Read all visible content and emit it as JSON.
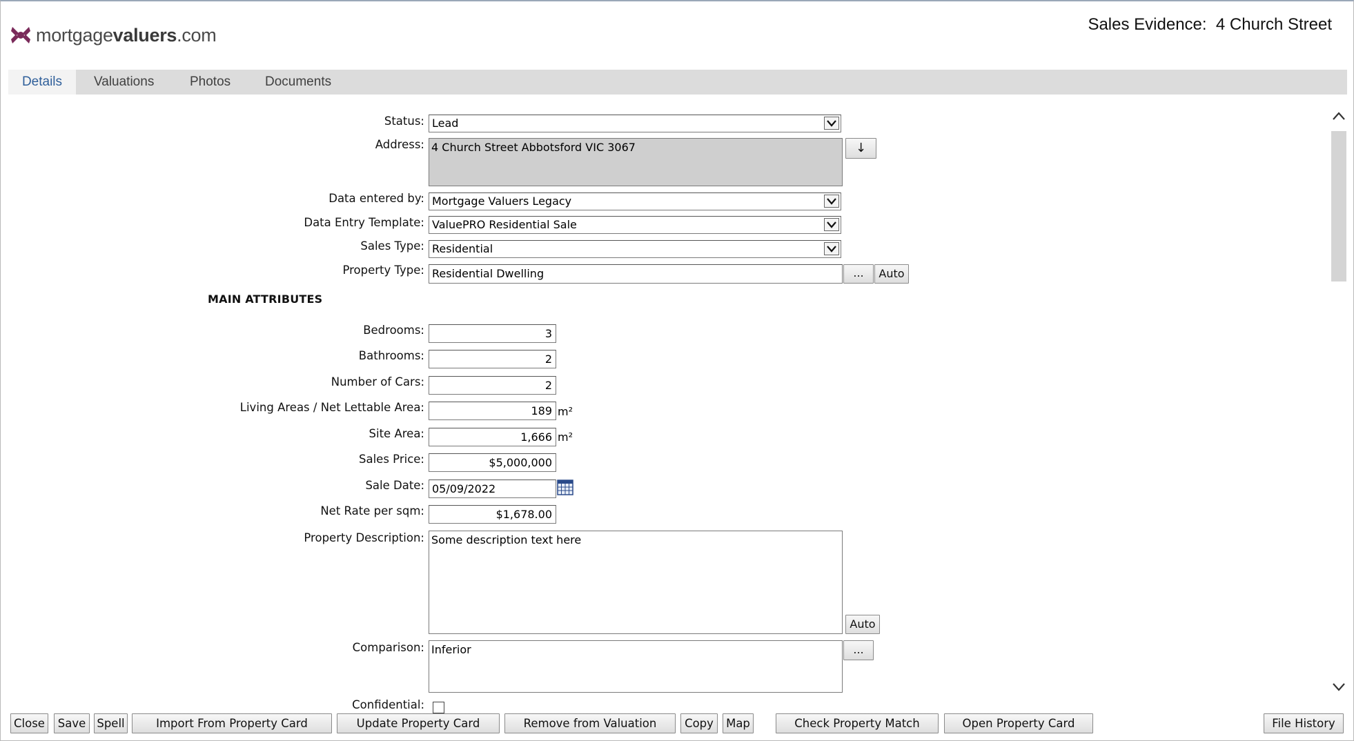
{
  "header": {
    "logo_text_light": "mortgage",
    "logo_text_bold": "valuers",
    "logo_text_tail": ".com",
    "title_prefix": "Sales Evidence:",
    "title_address": "4 Church Street"
  },
  "tabs": [
    {
      "label": "Details",
      "active": true
    },
    {
      "label": "Valuations",
      "active": false
    },
    {
      "label": "Photos",
      "active": false
    },
    {
      "label": "Documents",
      "active": false
    }
  ],
  "form": {
    "status": {
      "label": "Status:",
      "value": "Lead"
    },
    "address": {
      "label": "Address:",
      "value": "4 Church Street Abbotsford VIC 3067",
      "button": "↓"
    },
    "data_entered_by": {
      "label": "Data entered by:",
      "value": "Mortgage Valuers Legacy"
    },
    "data_entry_template": {
      "label": "Data Entry Template:",
      "value": "ValuePRO Residential Sale"
    },
    "sales_type": {
      "label": "Sales Type:",
      "value": "Residential"
    },
    "property_type": {
      "label": "Property Type:",
      "value": "Residential Dwelling",
      "browse_button": "...",
      "auto_button": "Auto"
    },
    "section_title": "MAIN ATTRIBUTES",
    "bedrooms": {
      "label": "Bedrooms:",
      "value": "3"
    },
    "bathrooms": {
      "label": "Bathrooms:",
      "value": "2"
    },
    "cars": {
      "label": "Number of Cars:",
      "value": "2"
    },
    "living_area": {
      "label": "Living Areas / Net Lettable Area:",
      "value": "189",
      "unit": "m²"
    },
    "site_area": {
      "label": "Site Area:",
      "value": "1,666",
      "unit": "m²"
    },
    "sales_price": {
      "label": "Sales Price:",
      "value": "$5,000,000"
    },
    "sale_date": {
      "label": "Sale Date:",
      "value": "05/09/2022"
    },
    "net_rate": {
      "label": "Net Rate per sqm:",
      "value": "$1,678.00"
    },
    "property_description": {
      "label": "Property Description:",
      "value": "Some description text here",
      "auto_button": "Auto"
    },
    "comparison": {
      "label": "Comparison:",
      "value": "Inferior",
      "browse_button": "..."
    },
    "confidential": {
      "label": "Confidential:",
      "checked": false
    }
  },
  "bottom_bar": {
    "close": "Close",
    "save": "Save",
    "spell": "Spell",
    "import": "Import From Property Card",
    "update": "Update Property Card",
    "remove": "Remove from Valuation",
    "copy": "Copy",
    "map": "Map",
    "check": "Check Property Match",
    "open": "Open Property Card",
    "history": "File History"
  },
  "colors": {
    "tab_active_text": "#2f5f9a",
    "tab_bar_bg": "#dcdcdc",
    "address_bg": "#cfcfcf",
    "logo_accent": "#7a2a5a"
  },
  "icons": {
    "logo": "mortgagevaluers-x-logo",
    "dropdown": "chevron-down-icon",
    "calendar": "calendar-icon",
    "scroll_up": "chevron-up-icon",
    "scroll_down": "chevron-down-icon"
  }
}
